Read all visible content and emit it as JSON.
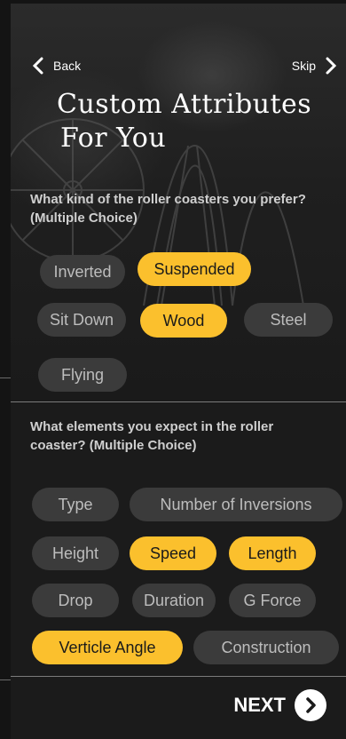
{
  "nav": {
    "back_label": "Back",
    "skip_label": "Skip"
  },
  "title_lines": [
    "Custom Attributes",
    "For You"
  ],
  "questions": {
    "coasters": "What kind of the roller coasters you prefer? (Multiple Choice)",
    "elements": "What elements you expect in the roller coaster? (Multiple Choice)"
  },
  "coaster_types": [
    {
      "label": "Inverted",
      "selected": false
    },
    {
      "label": "Suspended",
      "selected": true
    },
    {
      "label": "Sit Down",
      "selected": false
    },
    {
      "label": "Wood",
      "selected": true
    },
    {
      "label": "Steel",
      "selected": false
    },
    {
      "label": "Flying",
      "selected": false
    }
  ],
  "element_types": [
    {
      "label": "Type",
      "selected": false
    },
    {
      "label": "Number of Inversions",
      "selected": false
    },
    {
      "label": "Height",
      "selected": false
    },
    {
      "label": "Speed",
      "selected": true
    },
    {
      "label": "Length",
      "selected": true
    },
    {
      "label": "Drop",
      "selected": false
    },
    {
      "label": "Duration",
      "selected": false
    },
    {
      "label": "G Force",
      "selected": false
    },
    {
      "label": "Verticle Angle",
      "selected": true
    },
    {
      "label": "Construction",
      "selected": false
    }
  ],
  "next_label": "NEXT",
  "colors": {
    "accent": "#fbc02d",
    "chip": "#3b3b3b",
    "background": "#1b1b1b"
  }
}
